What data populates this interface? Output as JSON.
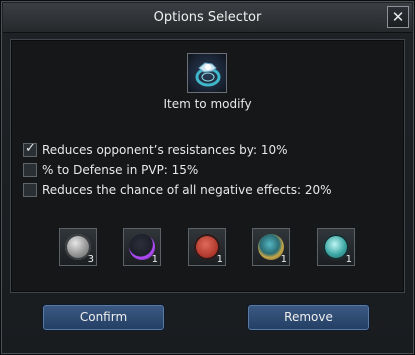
{
  "window": {
    "title": "Options Selector",
    "close_icon": "close-icon"
  },
  "item": {
    "label": "Item to modify",
    "icon": "ring-item-icon"
  },
  "options": [
    {
      "text": "Reduces opponent’s resistances by: 10%",
      "checked": true
    },
    {
      "text": "% to Defense in PVP: 15%",
      "checked": false
    },
    {
      "text": "Reduces the chance of all negative effects: 20%",
      "checked": false
    }
  ],
  "inventory": [
    {
      "icon": "gray-orb-icon",
      "count": "3",
      "color": "#9d9d9d"
    },
    {
      "icon": "purple-orb-icon",
      "count": "1",
      "color": "#b34dff"
    },
    {
      "icon": "red-orb-icon",
      "count": "1",
      "color": "#c0463c"
    },
    {
      "icon": "gold-orb-icon",
      "count": "1",
      "color": "#c4a64a"
    },
    {
      "icon": "teal-orb-icon",
      "count": "1",
      "color": "#3aa6a3"
    }
  ],
  "buttons": {
    "confirm": "Confirm",
    "remove": "Remove"
  }
}
